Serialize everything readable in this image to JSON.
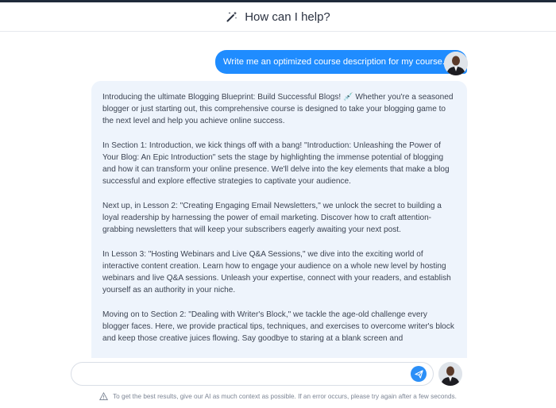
{
  "header": {
    "title": "How can I help?",
    "icon": "magic-wand-icon"
  },
  "chat": {
    "user_message": "Write me an optimized course description for my course.",
    "ai_paragraphs": [
      "Introducing the ultimate Blogging Blueprint: Build Successful Blogs! 💉 Whether you're a seasoned blogger or just starting out, this comprehensive course is designed to take your blogging game to the next level and help you achieve online success.",
      "In Section 1: Introduction, we kick things off with a bang! \"Introduction: Unleashing the Power of Your Blog: An Epic Introduction\" sets the stage by highlighting the immense potential of blogging and how it can transform your online presence. We'll delve into the key elements that make a blog successful and explore effective strategies to captivate your audience.",
      "Next up, in Lesson 2: \"Creating Engaging Email Newsletters,\" we unlock the secret to building a loyal readership by harnessing the power of email marketing. Discover how to craft attention-grabbing newsletters that will keep your subscribers eagerly awaiting your next post.",
      "In Lesson 3: \"Hosting Webinars and Live Q&A Sessions,\" we dive into the exciting world of interactive content creation. Learn how to engage your audience on a whole new level by hosting webinars and live Q&A sessions. Unleash your expertise, connect with your readers, and establish yourself as an authority in your niche.",
      "Moving on to Section 2: \"Dealing with Writer's Block,\" we tackle the age-old challenge every blogger faces. Here, we provide practical tips, techniques, and exercises to overcome writer's block and keep those creative juices flowing. Say goodbye to staring at a blank screen and"
    ]
  },
  "composer": {
    "placeholder": "",
    "value": ""
  },
  "footer": {
    "note": "To get the best results, give our AI as much context as possible. If an error occurs, please try again after a few seconds."
  },
  "colors": {
    "accent": "#1f8cff",
    "bubble_bg": "#eef4fc",
    "topbar": "#1f2a3a"
  }
}
